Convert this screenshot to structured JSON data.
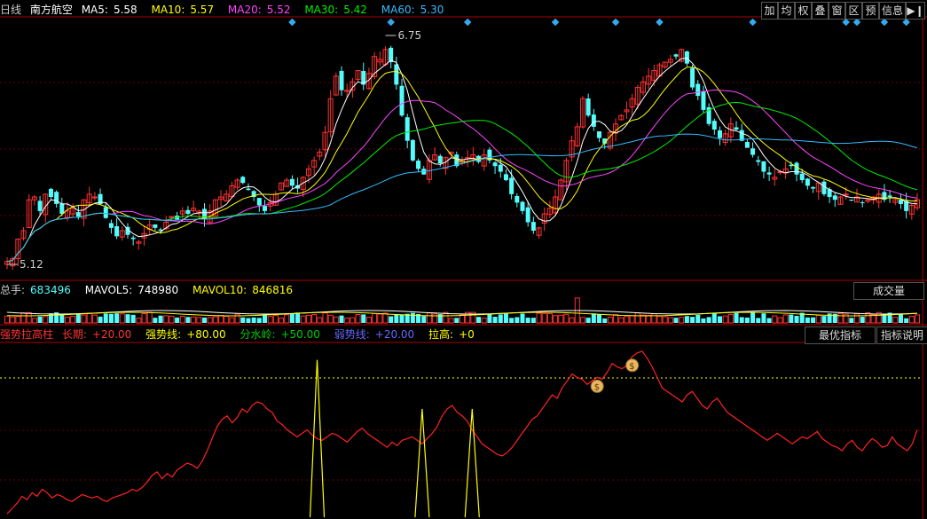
{
  "header": {
    "period": "日线",
    "stock": "南方航空",
    "ma": [
      {
        "label": "MA5:",
        "value": "5.58",
        "color": "#ffffff"
      },
      {
        "label": "MA10:",
        "value": "5.57",
        "color": "#ffff00"
      },
      {
        "label": "MA20:",
        "value": "5.52",
        "color": "#ff44ff"
      },
      {
        "label": "MA30:",
        "value": "5.42",
        "color": "#00ee00"
      },
      {
        "label": "MA60:",
        "value": "5.30",
        "color": "#33bbff"
      }
    ],
    "toolbar": [
      "加",
      "均",
      "权",
      "叠",
      "窗",
      "区",
      "预"
    ],
    "info_label": "信息"
  },
  "price": {
    "high_label": "6.75",
    "low_label": "5.12"
  },
  "volume": {
    "total_label": "总手:",
    "total_value": "683496",
    "mavol5_label": "MAVOL5:",
    "mavol5_value": "748980",
    "mavol10_label": "MAVOL10:",
    "mavol10_value": "846816",
    "button": "成交量"
  },
  "indicator": {
    "name": "强势拉高柱",
    "params": [
      {
        "label": "长期:",
        "value": "+20.00",
        "color": "#ff3333"
      },
      {
        "label": "强势线:",
        "value": "+80.00",
        "color": "#ffff00"
      },
      {
        "label": "分水岭:",
        "value": "+50.00",
        "color": "#00cc00"
      },
      {
        "label": "弱势线:",
        "value": "+20.00",
        "color": "#6666ff"
      },
      {
        "label": "拉高:",
        "value": "+0",
        "color": "#ffff00"
      }
    ],
    "best_button": "最优指标",
    "help_button": "指标说明",
    "coin_glyph": "$"
  },
  "colors": {
    "up": "#ff3232",
    "down": "#54fcfc",
    "bg": "#000000"
  },
  "chart_data": {
    "type": "candlestick",
    "high": 6.75,
    "low": 5.12,
    "close": [
      5.14,
      5.16,
      5.3,
      5.36,
      5.58,
      5.6,
      5.5,
      5.62,
      5.6,
      5.55,
      5.48,
      5.5,
      5.52,
      5.46,
      5.58,
      5.62,
      5.6,
      5.55,
      5.45,
      5.38,
      5.32,
      5.36,
      5.33,
      5.3,
      5.28,
      5.34,
      5.4,
      5.38,
      5.36,
      5.42,
      5.46,
      5.44,
      5.5,
      5.48,
      5.52,
      5.5,
      5.44,
      5.5,
      5.58,
      5.6,
      5.62,
      5.68,
      5.72,
      5.7,
      5.65,
      5.6,
      5.54,
      5.5,
      5.56,
      5.62,
      5.7,
      5.72,
      5.68,
      5.66,
      5.74,
      5.8,
      5.86,
      5.92,
      6.06,
      6.3,
      6.46,
      6.36,
      6.36,
      6.42,
      6.5,
      6.4,
      6.48,
      6.6,
      6.58,
      6.65,
      6.56,
      6.4,
      6.18,
      6.0,
      5.86,
      5.8,
      5.76,
      5.86,
      5.9,
      5.84,
      5.88,
      5.92,
      5.82,
      5.86,
      5.88,
      5.9,
      5.85,
      5.9,
      5.86,
      5.82,
      5.78,
      5.72,
      5.62,
      5.56,
      5.5,
      5.42,
      5.36,
      5.38,
      5.48,
      5.52,
      5.6,
      5.72,
      5.86,
      6.0,
      6.1,
      6.3,
      6.18,
      6.1,
      6.02,
      5.98,
      6.06,
      6.12,
      6.18,
      6.22,
      6.3,
      6.38,
      6.42,
      6.46,
      6.5,
      6.54,
      6.56,
      6.58,
      6.6,
      6.65,
      6.55,
      6.38,
      6.32,
      6.22,
      6.12,
      6.08,
      6.02,
      6.05,
      6.12,
      6.08,
      6.0,
      5.95,
      5.9,
      5.85,
      5.78,
      5.76,
      5.74,
      5.78,
      5.8,
      5.82,
      5.76,
      5.72,
      5.68,
      5.66,
      5.7,
      5.62,
      5.6,
      5.58,
      5.6,
      5.62,
      5.58,
      5.6,
      5.56,
      5.58,
      5.6,
      5.62,
      5.58,
      5.6,
      5.58,
      5.55,
      5.5,
      5.54,
      5.58
    ],
    "volume_ma": [
      683496,
      748980,
      846816
    ],
    "indicator": {
      "strong_line": 80,
      "watershed": 50,
      "weak_line": 20,
      "long_term": [
        2,
        5,
        8,
        12,
        10,
        14,
        12,
        16,
        14,
        11,
        13,
        12,
        10,
        9,
        11,
        13,
        12,
        11,
        12,
        10,
        9,
        11,
        12,
        13,
        14,
        16,
        15,
        17,
        20,
        24,
        26,
        22,
        25,
        23,
        27,
        29,
        31,
        30,
        28,
        32,
        38,
        45,
        52,
        56,
        58,
        54,
        57,
        62,
        60,
        64,
        66,
        65,
        62,
        60,
        55,
        53,
        50,
        48,
        46,
        48,
        50,
        47,
        45,
        44,
        46,
        48,
        47,
        45,
        43,
        46,
        49,
        51,
        48,
        46,
        44,
        42,
        40,
        43,
        41,
        44,
        45,
        46,
        44,
        42,
        45,
        48,
        52,
        58,
        62,
        64,
        60,
        58,
        55,
        50,
        46,
        42,
        40,
        38,
        36,
        35,
        37,
        40,
        44,
        48,
        52,
        56,
        58,
        62,
        66,
        70,
        68,
        74,
        78,
        82,
        80,
        79,
        76,
        78,
        80,
        79,
        83,
        88,
        86,
        85,
        87,
        92,
        94,
        95,
        91,
        86,
        80,
        74,
        72,
        70,
        68,
        66,
        70,
        72,
        68,
        64,
        62,
        66,
        68,
        64,
        60,
        58,
        56,
        54,
        52,
        50,
        48,
        46,
        44,
        46,
        48,
        46,
        44,
        42,
        44,
        46,
        45,
        47,
        49,
        45,
        43,
        41,
        40,
        38,
        42,
        44,
        40,
        38,
        42,
        45,
        43,
        40,
        41,
        46,
        42,
        40,
        38,
        42,
        50
      ],
      "lift_peaks": [
        [
          62,
          90
        ],
        [
          83,
          62
        ],
        [
          93,
          62
        ]
      ],
      "signals": [
        118,
        125
      ]
    }
  }
}
